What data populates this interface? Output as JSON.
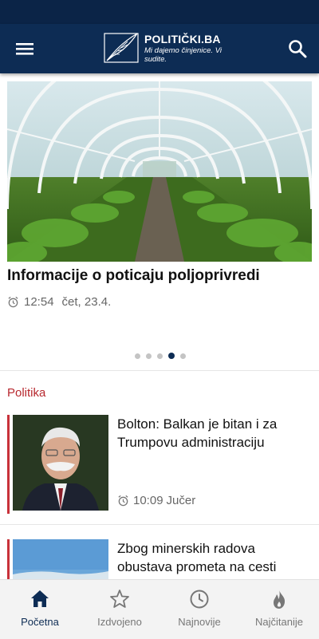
{
  "app": {
    "name": "POLITIČKI.BA",
    "tagline": "Mi dajemo činjenice. Vi sudite."
  },
  "header": {
    "menu_icon": "hamburger-menu-icon",
    "search_icon": "search-icon"
  },
  "carousel": {
    "title": "Informacije o poticaju poljoprivredi",
    "time": "12:54",
    "date": "čet, 23.4.",
    "dot_count": 5,
    "active_index": 3
  },
  "section": {
    "label": "Politika"
  },
  "articles": [
    {
      "title": "Bolton: Balkan je bitan i za Trumpovu administraciju",
      "time": "10:09",
      "when": "Jučer"
    },
    {
      "title": "Zbog minerskih radova obustava prometa na cesti Stolac-Neum",
      "time": "",
      "when": ""
    }
  ],
  "bottom_nav": [
    {
      "label": "Početna",
      "icon": "home-icon",
      "active": true
    },
    {
      "label": "Izdvojeno",
      "icon": "star-icon",
      "active": false
    },
    {
      "label": "Najnovije",
      "icon": "clock-icon",
      "active": false
    },
    {
      "label": "Najčitanije",
      "icon": "flame-icon",
      "active": false
    }
  ],
  "colors": {
    "brand_navy": "#0d2c54",
    "section_red": "#b7282e",
    "accent_red": "#c8323a"
  }
}
